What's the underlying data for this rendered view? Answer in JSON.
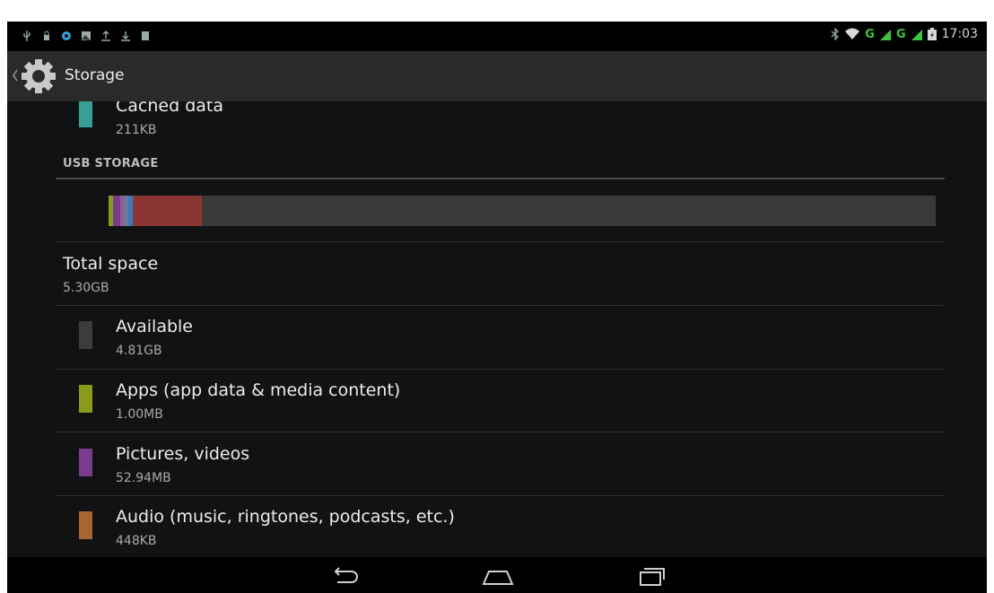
{
  "status_bar": {
    "time": "17:03",
    "network_labels": [
      "G",
      "G"
    ],
    "left_icons": [
      "usb-icon",
      "lock-icon",
      "sync-icon",
      "image-icon",
      "upload-icon",
      "download-icon",
      "storage-icon"
    ],
    "right_icons": [
      "bluetooth-icon",
      "wifi-icon",
      "signal-icon",
      "signal-icon",
      "battery-icon"
    ]
  },
  "action_bar": {
    "title": "Storage",
    "icon": "settings-gear-icon"
  },
  "cached": {
    "title": "Cached data",
    "size": "211KB",
    "color": "#3a9e98"
  },
  "usb_storage": {
    "header": "USB STORAGE",
    "bar_background": "#3a3a3a",
    "usage_segments": [
      {
        "color": "#8a9a1b",
        "fraction": 0.0054
      },
      {
        "color": "#7a3d8c",
        "fraction": 0.0087
      },
      {
        "color": "#9a5a9a",
        "fraction": 0.0043
      },
      {
        "color": "#6b7a9a",
        "fraction": 0.0054
      },
      {
        "color": "#3a78b8",
        "fraction": 0.0054
      },
      {
        "color": "#8b3535",
        "fraction": 0.0835
      }
    ],
    "total": {
      "title": "Total space",
      "size": "5.30GB"
    },
    "items": [
      {
        "title": "Available",
        "size": "4.81GB",
        "color": "#3c3c3c"
      },
      {
        "title": "Apps (app data & media content)",
        "size": "1.00MB",
        "color": "#8a9a1b"
      },
      {
        "title": "Pictures, videos",
        "size": "52.94MB",
        "color": "#7a3d8c"
      },
      {
        "title": "Audio (music, ringtones, podcasts, etc.)",
        "size": "448KB",
        "color": "#a86532"
      }
    ]
  },
  "nav_bar": {
    "buttons": [
      "back-icon",
      "home-icon",
      "recent-apps-icon"
    ]
  }
}
